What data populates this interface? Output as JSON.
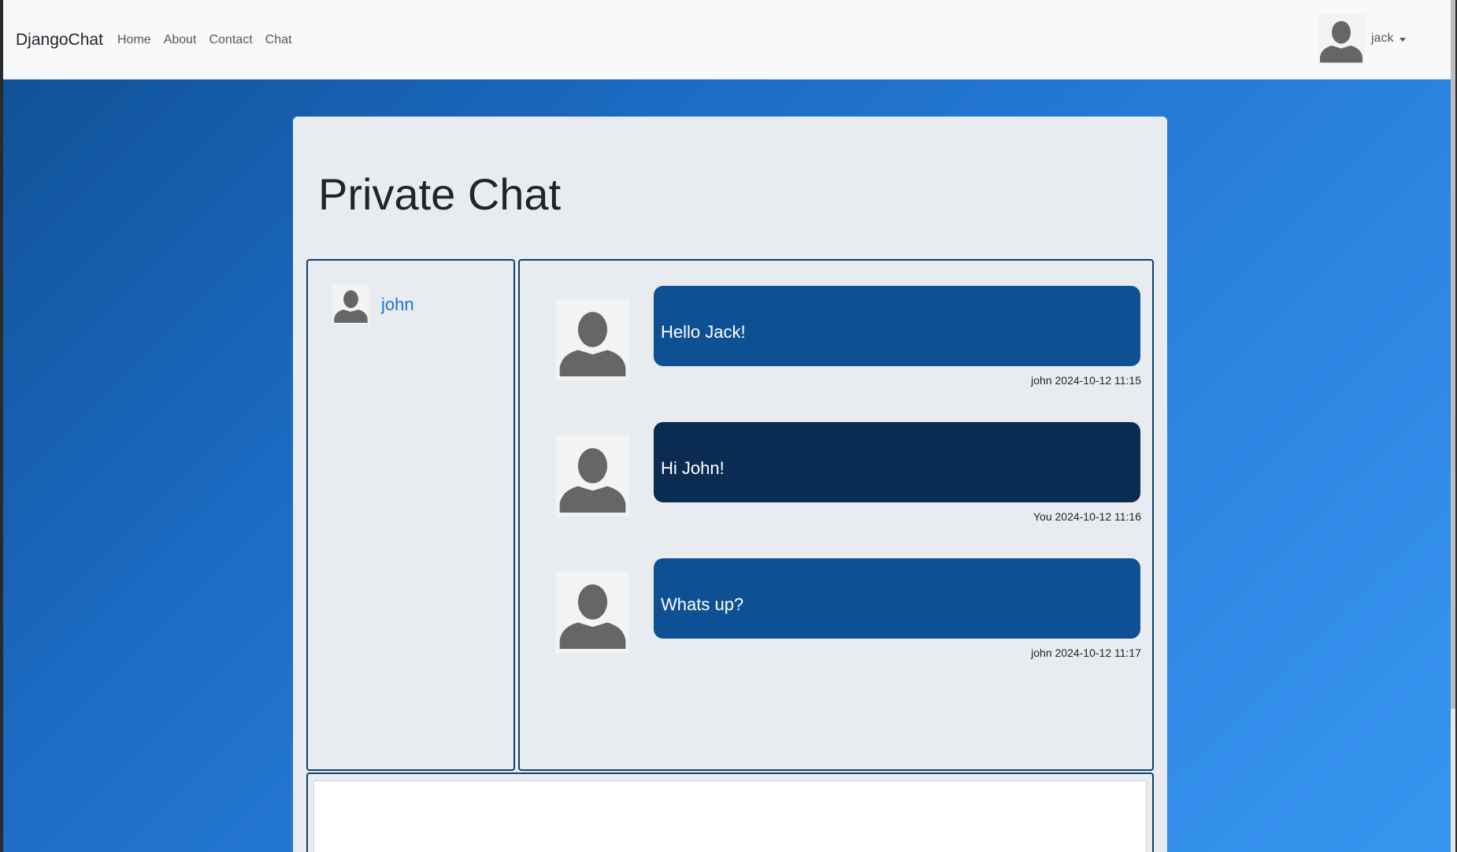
{
  "navbar": {
    "brand": "DjangoChat",
    "links": [
      "Home",
      "About",
      "Contact",
      "Chat"
    ],
    "user": {
      "name": "jack",
      "avatar_icon": "user-silhouette-icon"
    }
  },
  "page": {
    "title": "Private Chat"
  },
  "contacts": [
    {
      "name": "john",
      "avatar_icon": "user-silhouette-icon"
    }
  ],
  "messages": [
    {
      "text": "Hello Jack!",
      "author": "john",
      "time": "2024-10-12 11:15",
      "meta": "john 2024-10-12 11:15",
      "from_self": false
    },
    {
      "text": "Hi John!",
      "author": "You",
      "time": "2024-10-12 11:16",
      "meta": "You 2024-10-12 11:16",
      "from_self": true
    },
    {
      "text": "Whats up?",
      "author": "john",
      "time": "2024-10-12 11:17",
      "meta": "john 2024-10-12 11:17",
      "from_self": false
    }
  ],
  "composer": {
    "value": "",
    "placeholder": ""
  },
  "colors": {
    "bubble_other": "#0e5094",
    "bubble_self": "#0b2c52",
    "contact_link": "#1a73d9",
    "panel_border": "#123e6e"
  }
}
